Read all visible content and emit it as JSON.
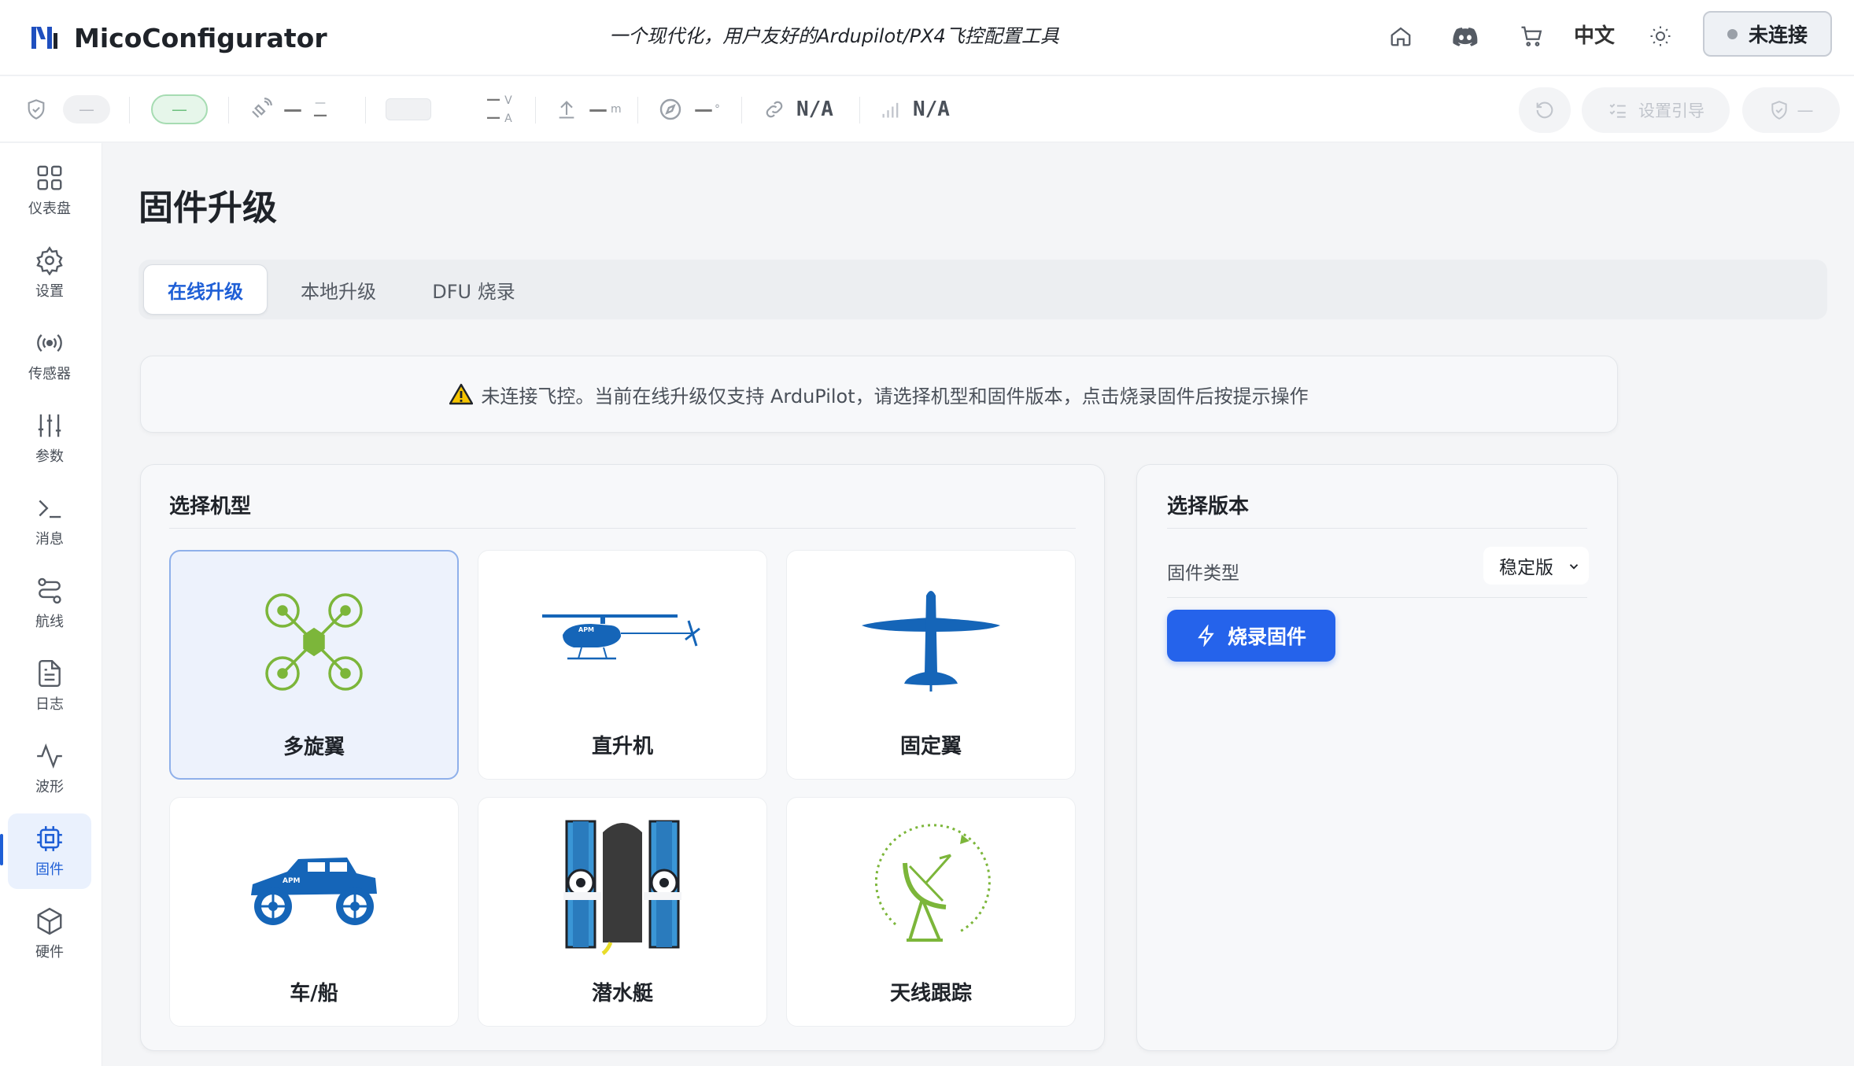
{
  "app": {
    "name": "MicoConfigurator",
    "tagline": "一个现代化，用户友好的Ardupilot/PX4飞控配置工具",
    "language": "中文",
    "connect_label": "未连接"
  },
  "statusbar": {
    "dash": "—",
    "voltage_unit": "V",
    "current_unit": "A",
    "altitude_unit": "m",
    "heading_unit": "°",
    "link": "N/A",
    "signal": "N/A",
    "setup_guide": "设置引导"
  },
  "sidebar": {
    "items": [
      {
        "label": "仪表盘",
        "icon": "dashboard-icon"
      },
      {
        "label": "设置",
        "icon": "settings-icon"
      },
      {
        "label": "传感器",
        "icon": "sensor-icon"
      },
      {
        "label": "参数",
        "icon": "sliders-icon"
      },
      {
        "label": "消息",
        "icon": "terminal-icon"
      },
      {
        "label": "航线",
        "icon": "route-icon"
      },
      {
        "label": "日志",
        "icon": "file-icon"
      },
      {
        "label": "波形",
        "icon": "waveform-icon"
      },
      {
        "label": "固件",
        "icon": "chip-icon",
        "active": true
      },
      {
        "label": "硬件",
        "icon": "cube-icon"
      }
    ]
  },
  "page": {
    "title": "固件升级",
    "tabs": [
      {
        "label": "在线升级",
        "active": true
      },
      {
        "label": "本地升级"
      },
      {
        "label": "DFU 烧录"
      }
    ],
    "notice": "未连接飞控。当前在线升级仅支持 ArduPilot，请选择机型和固件版本，点击烧录固件后按提示操作"
  },
  "vehicle_panel": {
    "title": "选择机型",
    "vehicles": [
      {
        "label": "多旋翼",
        "selected": true
      },
      {
        "label": "直升机"
      },
      {
        "label": "固定翼"
      },
      {
        "label": "车/船"
      },
      {
        "label": "潜水艇"
      },
      {
        "label": "天线跟踪"
      }
    ],
    "logo_text": "APM"
  },
  "version_panel": {
    "title": "选择版本",
    "firmware_type_label": "固件类型",
    "firmware_type_value": "稳定版",
    "flash_button": "烧录固件"
  },
  "colors": {
    "accent": "#2563eb",
    "vehicle_blue": "#1565b8",
    "multirotor_green": "#7cb63a"
  }
}
